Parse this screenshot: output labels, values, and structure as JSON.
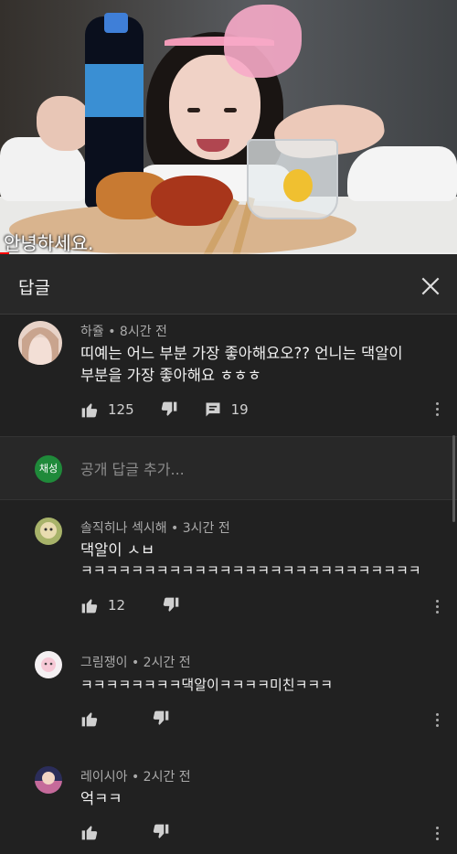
{
  "video": {
    "subtitle": "안녕하세요.",
    "progress": 0.02
  },
  "header": {
    "title": "답글"
  },
  "main_comment": {
    "author": "하쥴 • 8시간 전",
    "text_line1": "띠예는  어느 부분 가장 좋아해요오?? 언니는 댁알이",
    "text_line2": "부분을 가장 좋아해요 ㅎㅎㅎ",
    "likes": "125",
    "replies": "19"
  },
  "reply_box": {
    "avatar_label": "채성",
    "placeholder": "공개 답글 추가..."
  },
  "replies": [
    {
      "author": "솔직히나 섹시해 • 3시간 전",
      "text_line1": "댁알이 ㅅㅂ",
      "text_line2": "ㅋㅋㅋㅋㅋㅋㅋㅋㅋㅋㅋㅋㅋㅋㅋㅋㅋㅋㅋㅋㅋㅋㅋㅋㅋㅋㅋ",
      "likes": "12"
    },
    {
      "author": "그림쟁이 • 2시간 전",
      "text_line1": "ㅋㅋㅋㅋㅋㅋㅋㅋ댁알이ㅋㅋㅋㅋ미친ㅋㅋㅋ",
      "likes": ""
    },
    {
      "author": "레이시아 • 2시간 전",
      "text_line1": "억ㅋㅋ",
      "likes": ""
    }
  ],
  "colors": {
    "background": "#212121",
    "header": "#282828",
    "text": "#f1f1f1",
    "meta": "#aaaaaa",
    "progress": "#ff0000"
  }
}
